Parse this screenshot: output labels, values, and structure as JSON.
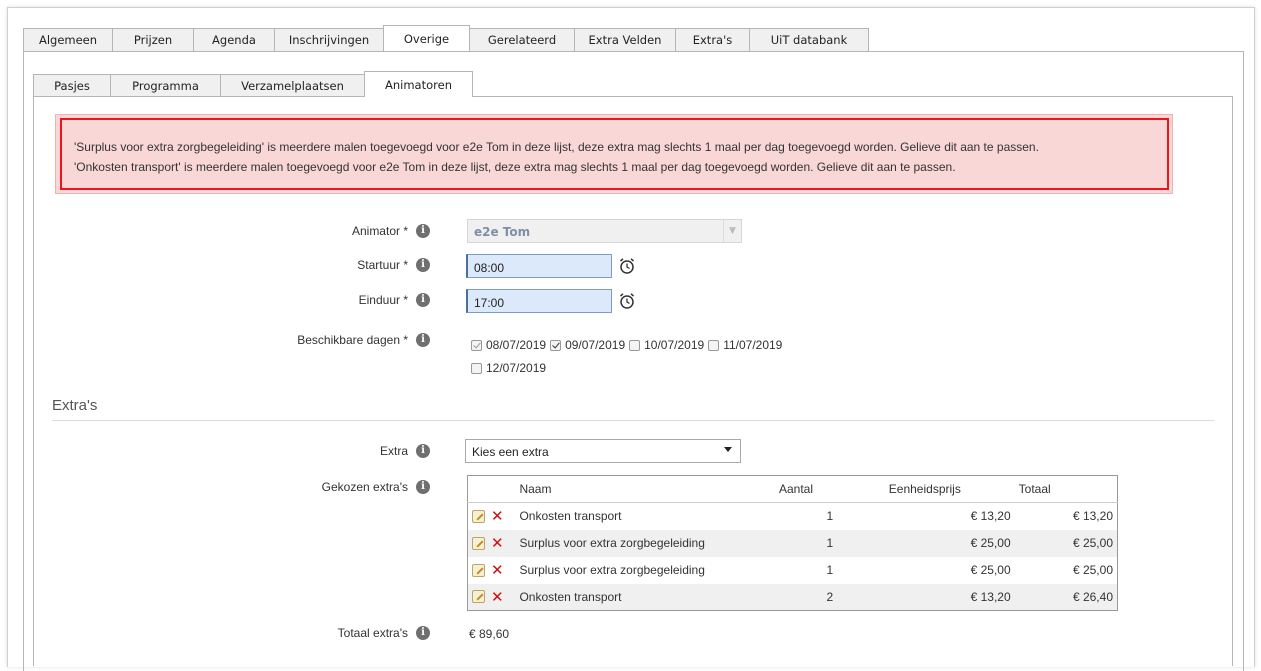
{
  "main_tabs": [
    "Algemeen",
    "Prijzen",
    "Agenda",
    "Inschrijvingen",
    "Overige",
    "Gerelateerd",
    "Extra Velden",
    "Extra's",
    "UiT databank"
  ],
  "main_tabs_active": "Overige",
  "sub_tabs": [
    "Pasjes",
    "Programma",
    "Verzamelplaatsen",
    "Animatoren"
  ],
  "sub_tabs_active": "Animatoren",
  "error": {
    "line1": "'Surplus voor extra zorgbegeleiding' is meerdere malen toegevoegd voor e2e Tom in deze lijst, deze extra mag slechts 1 maal per dag toegevoegd worden. Gelieve dit aan te passen.",
    "line2": "'Onkosten transport' is meerdere malen toegevoegd voor e2e Tom in deze lijst, deze extra mag slechts 1 maal per dag toegevoegd worden. Gelieve dit aan te passen.",
    "border_color": "#e8161e",
    "background_color": "#f9d7d7"
  },
  "form": {
    "animator_label": "Animator *",
    "animator_value": "e2e Tom",
    "startuur_label": "Startuur *",
    "startuur_value": "08:00",
    "einduur_label": "Einduur *",
    "einduur_value": "17:00",
    "dagen_label": "Beschikbare dagen *",
    "dagen": [
      {
        "label": "08/07/2019",
        "checked": true,
        "disabled": true
      },
      {
        "label": "09/07/2019",
        "checked": true,
        "disabled": false
      },
      {
        "label": "10/07/2019",
        "checked": false,
        "disabled": false
      },
      {
        "label": "11/07/2019",
        "checked": false,
        "disabled": false
      },
      {
        "label": "12/07/2019",
        "checked": false,
        "disabled": false
      }
    ],
    "info_glyph": "i"
  },
  "extras": {
    "section_title": "Extra's",
    "extra_label": "Extra",
    "extra_select_value": "Kies een extra",
    "gekozen_label": "Gekozen extra's",
    "columns": [
      "Naam",
      "Aantal",
      "Eenheidsprijs",
      "Totaal"
    ],
    "rows": [
      {
        "naam": "Onkosten transport",
        "aantal": "1",
        "eenheidsprijs": "€ 13,20",
        "totaal": "€ 13,20"
      },
      {
        "naam": "Surplus voor extra zorgbegeleiding",
        "aantal": "1",
        "eenheidsprijs": "€ 25,00",
        "totaal": "€ 25,00"
      },
      {
        "naam": "Surplus voor extra zorgbegeleiding",
        "aantal": "1",
        "eenheidsprijs": "€ 25,00",
        "totaal": "€ 25,00"
      },
      {
        "naam": "Onkosten transport",
        "aantal": "2",
        "eenheidsprijs": "€ 13,20",
        "totaal": "€ 26,40"
      }
    ],
    "totaal_label": "Totaal extra's",
    "totaal_value": "€ 89,60",
    "delete_glyph": "✕"
  },
  "icons": {
    "info": "info-icon",
    "clock": "alarm-clock-icon",
    "edit": "edit-pencil-icon",
    "delete": "delete-x-icon"
  }
}
